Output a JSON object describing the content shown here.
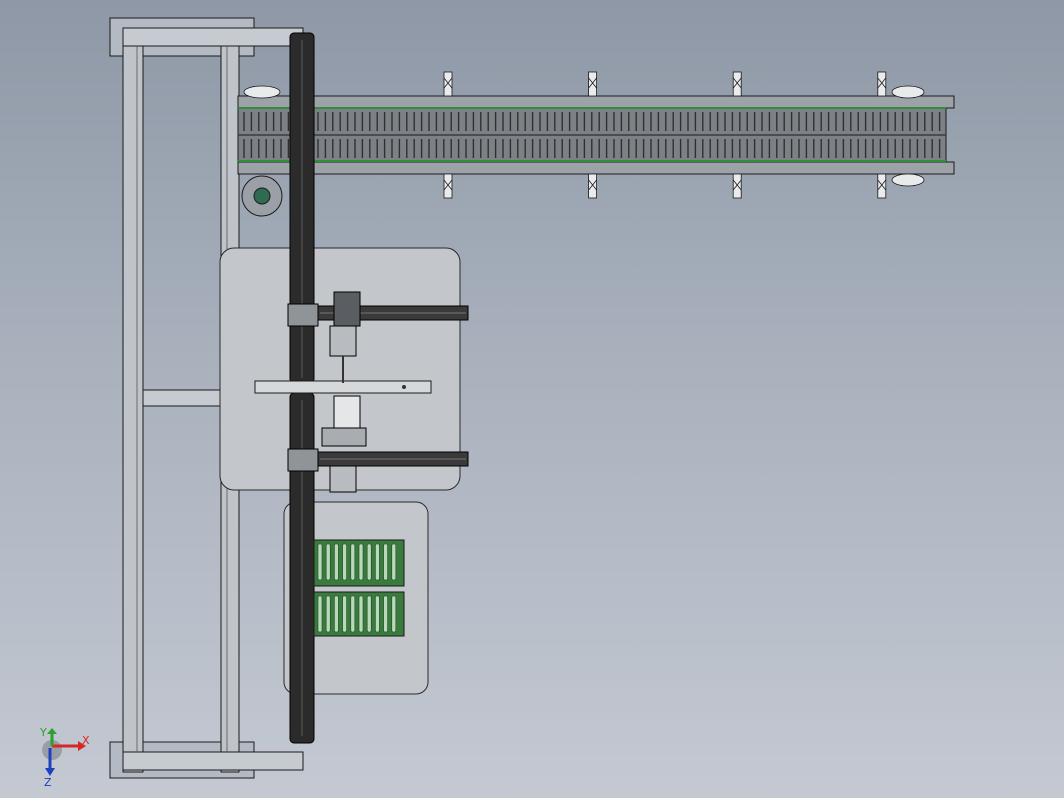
{
  "view": {
    "background_top": "#8e98a6",
    "background_bottom": "#c4c9d2"
  },
  "colors": {
    "frame_fill": "#b4bac3",
    "frame_edge": "#1a1a1a",
    "plate_fill": "#c3c6ca",
    "rail_fill": "#2b2b2b",
    "belt_fill": "#7d8186",
    "belt_stripe": "#2f8f3a",
    "tray_fill": "#3a7a3f",
    "tray_slot": "#b9d9bb",
    "axis_x": "#d62728",
    "axis_y": "#2ca02c",
    "axis_z": "#1f3fbf"
  },
  "triad": {
    "x_label": "X",
    "y_label": "Y",
    "z_label": "Z"
  },
  "model": {
    "belt_rollers": 4,
    "tray_rows": 2,
    "tray_slots_per_row": 10,
    "gantry_arms": 2
  }
}
